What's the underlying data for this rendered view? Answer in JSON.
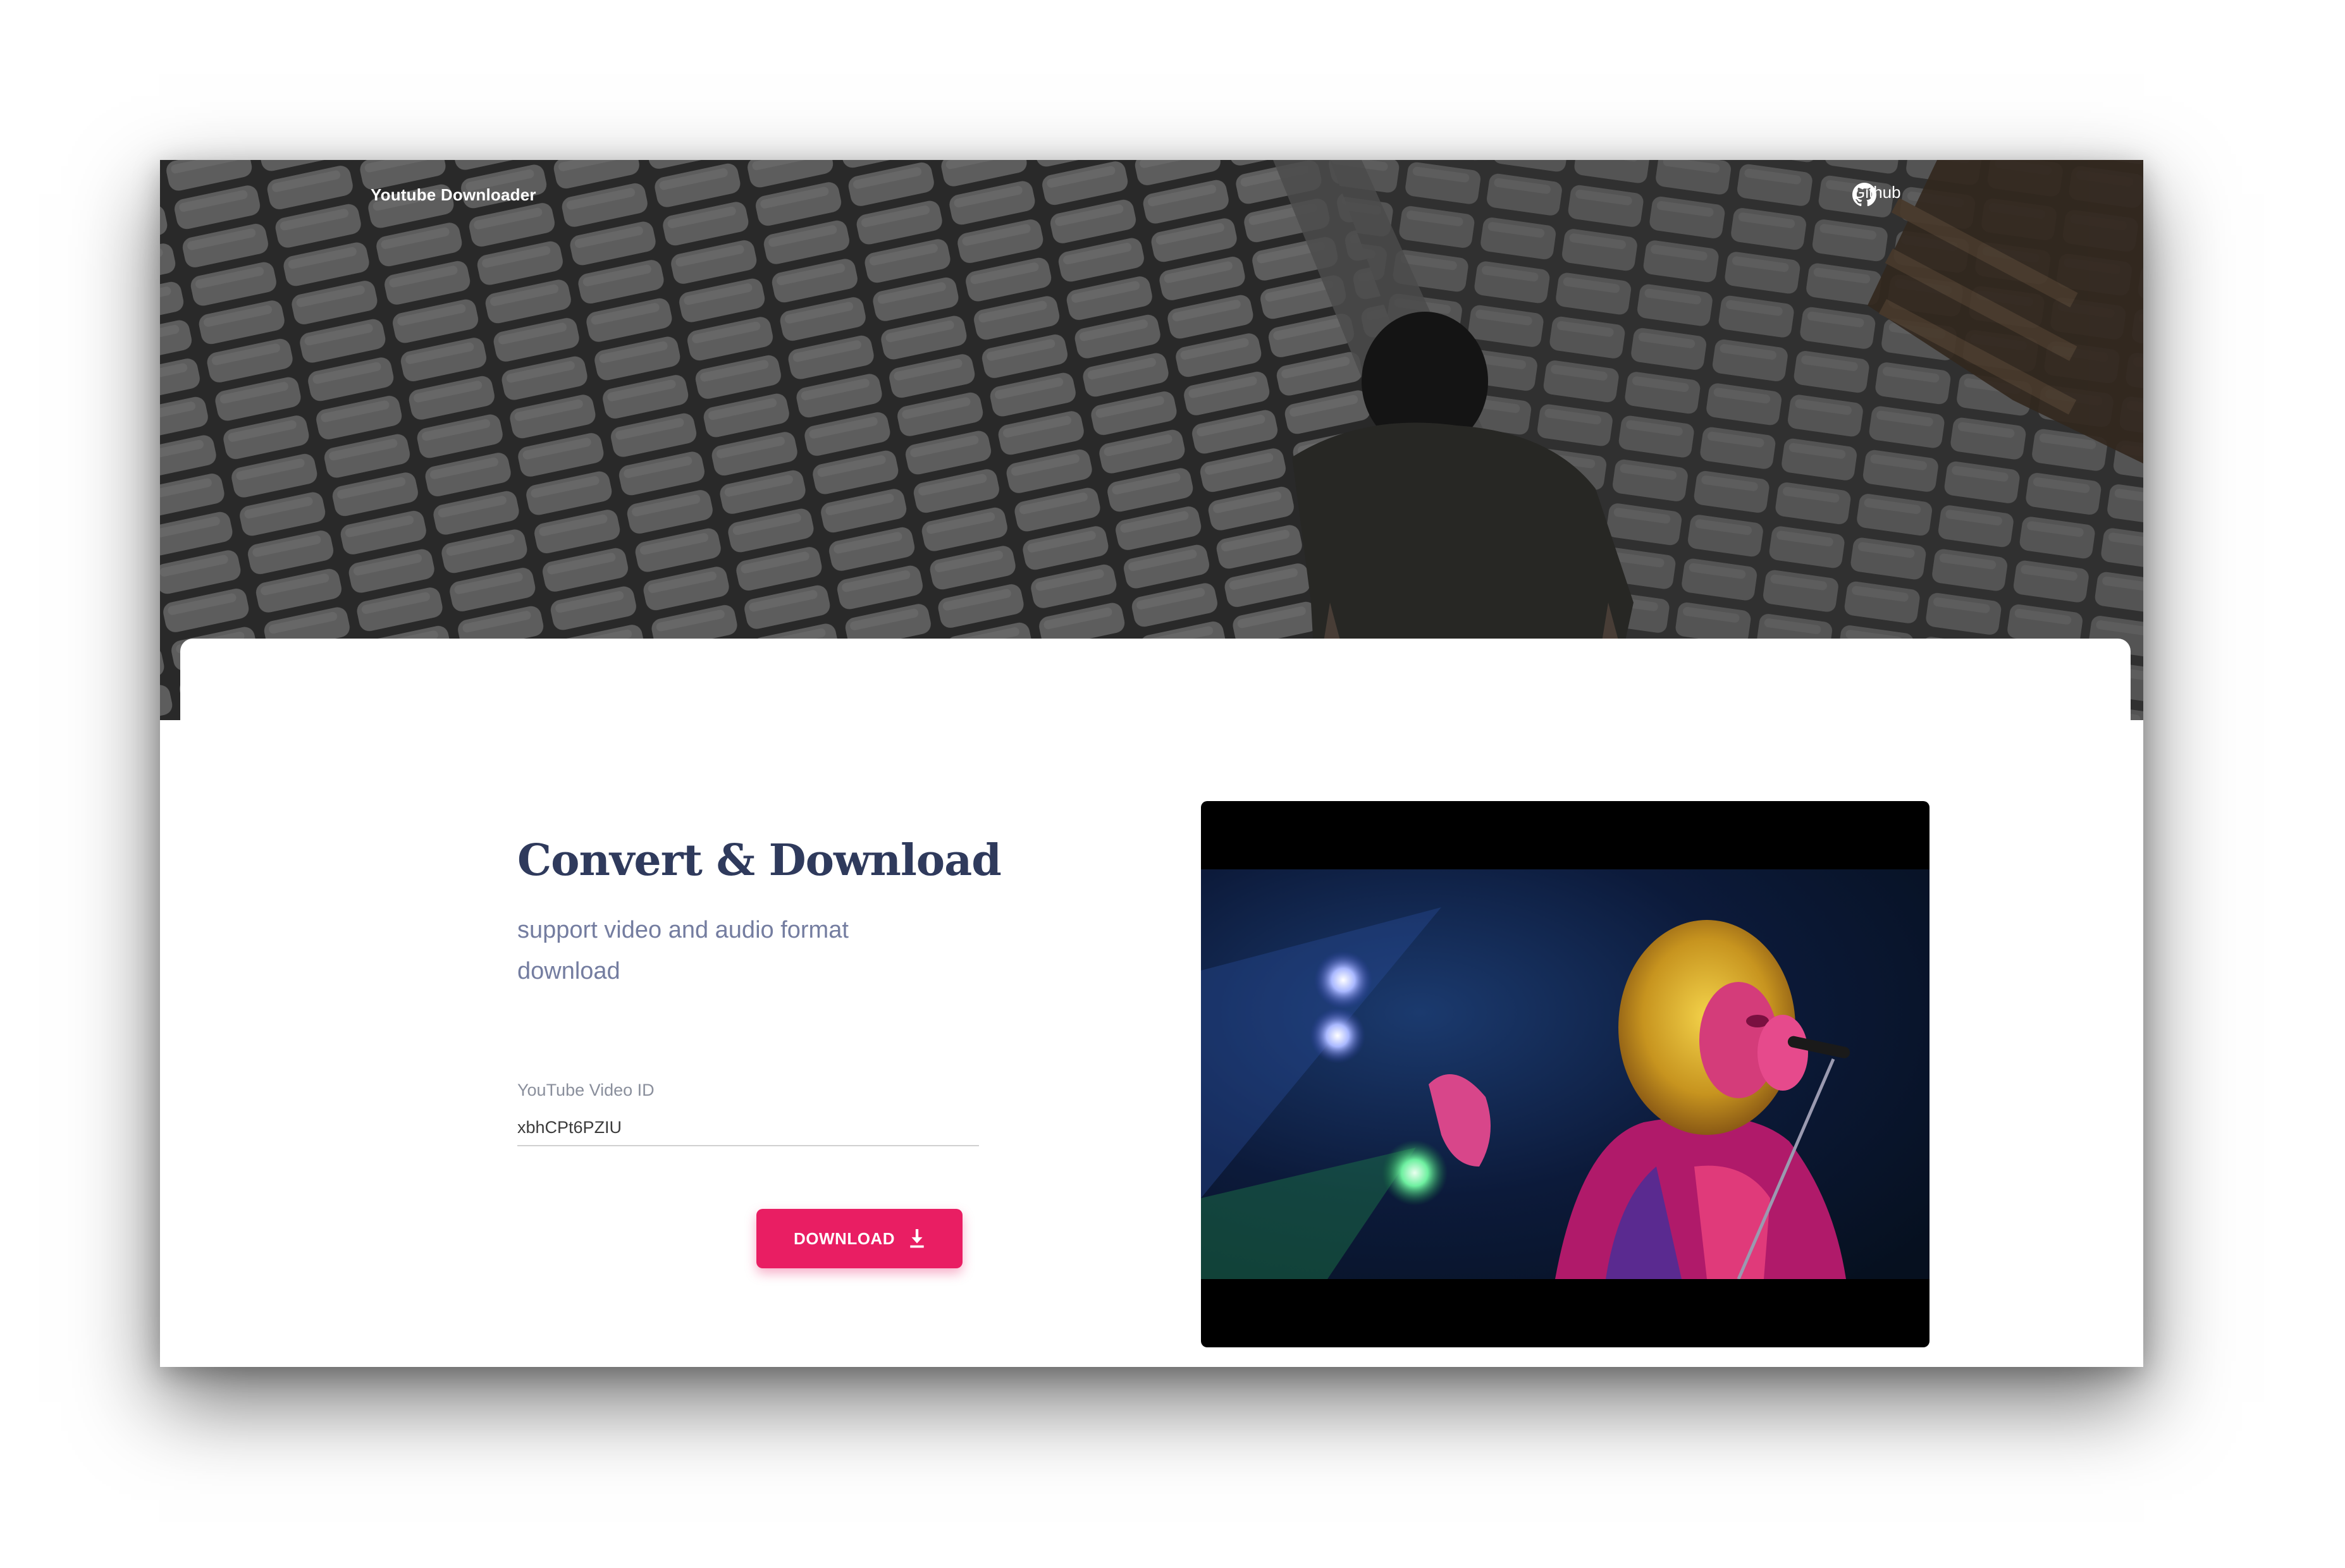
{
  "nav": {
    "brand": "Youtube Downloader",
    "github_label": "Github"
  },
  "hero": {
    "title": "Convert & Download",
    "subtitle": "support video and audio format download"
  },
  "form": {
    "video_id_label": "YouTube Video ID",
    "video_id_value": "xbhCPt6PZIU",
    "download_label": "DOWNLOAD"
  },
  "colors": {
    "accent": "#e91e63",
    "title": "#2f3a5c",
    "subtitle": "#747da0"
  },
  "icons": {
    "github": "github-icon",
    "download": "download-arrow-icon"
  }
}
